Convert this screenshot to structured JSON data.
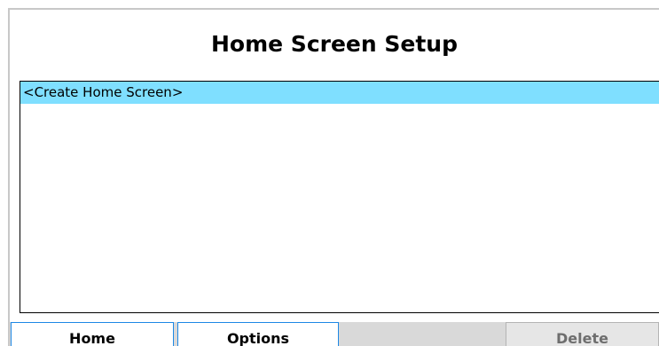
{
  "screen": {
    "title": "Home Screen Setup"
  },
  "list": {
    "items": [
      {
        "label": "<Create Home Screen>",
        "selected": true
      }
    ]
  },
  "softkeys": {
    "home": "Home",
    "options": "Options",
    "delete": "Delete"
  },
  "colors": {
    "selection": "#7fdfff",
    "softkey_border": "#1e88e5",
    "toolbar_bg": "#d9d9d9"
  }
}
